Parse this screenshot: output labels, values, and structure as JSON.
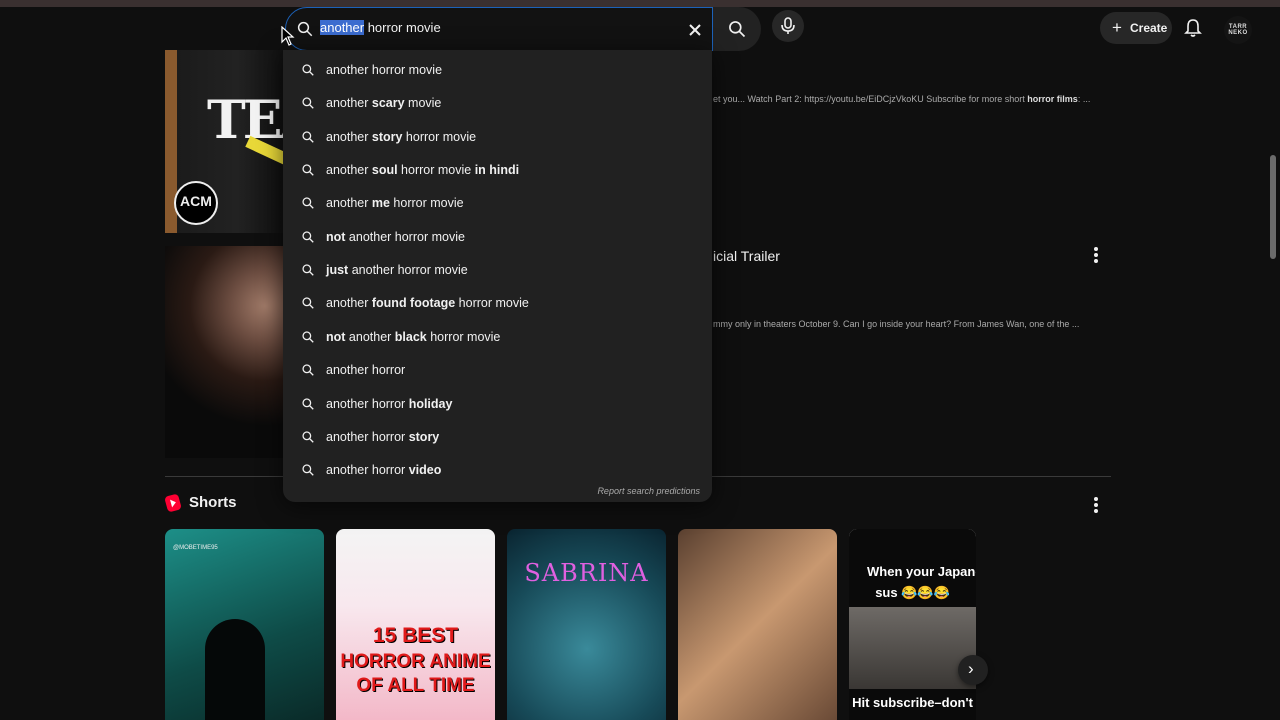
{
  "search": {
    "query_highlight": "another",
    "query_rest": " horror movie",
    "suggestions": [
      {
        "a": "another horror movie",
        "b": "",
        "c": ""
      },
      {
        "a": "another ",
        "b": "scary",
        "c": " movie"
      },
      {
        "a": "another ",
        "b": "story",
        "c": " horror movie"
      },
      {
        "a": "another ",
        "b": "soul",
        "c": " horror movie ",
        "d": "in hindi"
      },
      {
        "a": "another ",
        "b": "me",
        "c": " horror movie"
      },
      {
        "a": "",
        "b": "not",
        "c": " another horror movie"
      },
      {
        "a": "",
        "b": "just",
        "c": " another horror movie"
      },
      {
        "a": "another ",
        "b": "found footage",
        "c": " horror movie"
      },
      {
        "a": "",
        "b": "not",
        "c": " another ",
        "d": "black",
        "e": " horror movie"
      },
      {
        "a": "another horror",
        "b": "",
        "c": ""
      },
      {
        "a": "another horror ",
        "b": "holiday",
        "c": ""
      },
      {
        "a": "another horror ",
        "b": "story",
        "c": ""
      },
      {
        "a": "another horror ",
        "b": "video",
        "c": ""
      }
    ],
    "report_label": "Report search predictions"
  },
  "header": {
    "create_label": "Create",
    "avatar_text": "TARR NEKO"
  },
  "results": {
    "desc1_pre": "et you... Watch Part 2: https://youtu.be/EiDCjzVkoKU Subscribe for more short ",
    "desc1_bold": "horror films",
    "desc1_post": ": ...",
    "thumb1_text": "TEAC",
    "thumb1_logo": "ACM",
    "title2": "icial Trailer",
    "desc2": "mmy only in theaters October 9. Can I go inside your heart? From James Wan, one of the ..."
  },
  "shorts": {
    "title": "Shorts",
    "s1_tag": "@MOBETIME95",
    "s2_line1": "15 BEST",
    "s2_line2": "HORROR ANIME",
    "s2_line3": "OF ALL TIME",
    "s3_title": "SABRINA",
    "s5_line1": "When your Japanese",
    "s5_line2": "sus 😂😂😂",
    "s5_line3": "Hit subscribe–don't"
  },
  "colors": {
    "background": "#0f0f0f",
    "dropdown": "#212121",
    "focus_border": "#1c62b9",
    "highlight": "#3b6ccf",
    "shorts_red": "#ff0033"
  }
}
